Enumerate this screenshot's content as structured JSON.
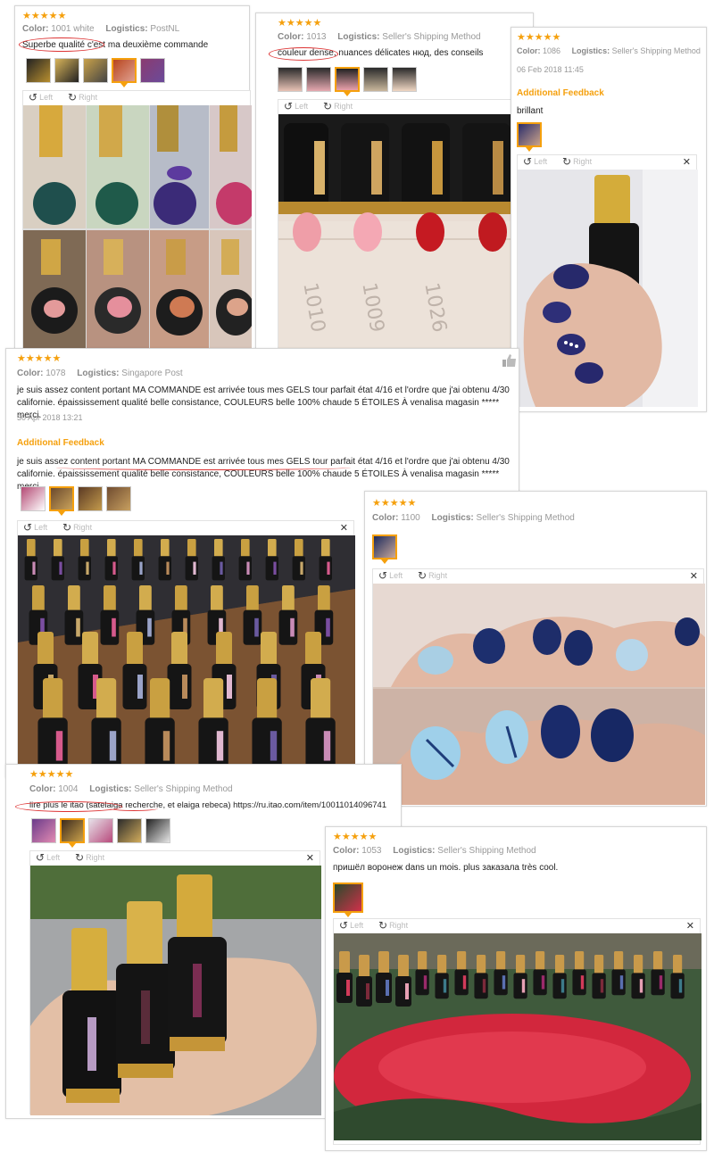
{
  "labels": {
    "color": "Color:",
    "logistics": "Logistics:",
    "left": "Left",
    "right": "Right",
    "additional": "Additional Feedback",
    "stars": "★★★★★"
  },
  "colors": {
    "accent": "#f5a00d",
    "annotation": "#d33333"
  },
  "reviews": [
    {
      "color": "1001 white",
      "logistics": "PostNL",
      "text": "Superbe qualité c'est ma deuxième commande"
    },
    {
      "color": "1013",
      "logistics": "Seller's Shipping Method",
      "text": "couleur dense, nuances délicates нюд, des conseils"
    },
    {
      "color": "1086",
      "logistics": "Seller's Shipping Method",
      "date": "06 Feb 2018 11:45",
      "additional": "brillant"
    },
    {
      "color": "1078",
      "logistics": "Singapore Post",
      "text": "je suis assez content portant MA COMMANDE est arrivée tous mes GELS tour parfait état 4/16 et l'ordre que j'ai obtenu 4/30 californie. épaississement qualité belle consistance, COULEURS belle 100% chaude 5 ÉTOILES À venalisa magasin ***** merci.",
      "date": "30 Apr 2018 13:21",
      "additional": "je suis assez content portant MA COMMANDE est arrivée tous mes GELS tour parfait état 4/16 et l'ordre que j'ai obtenu 4/30 californie. épaississement qualité belle consistance, COULEURS belle 100% chaude 5 ÉTOILES À venalisa magasin ***** merci."
    },
    {
      "color": "1100",
      "logistics": "Seller's Shipping Method"
    },
    {
      "color": "1004",
      "logistics": "Seller's Shipping Method",
      "text": "lire plus le itao (satelaiga recherche, et elaiga rebeca) https://ru.itao.com/item/10011014096741"
    },
    {
      "color": "1053",
      "logistics": "Seller's Shipping Method",
      "text": "пришёл воронеж dans un mois. plus заказала très cool."
    }
  ]
}
